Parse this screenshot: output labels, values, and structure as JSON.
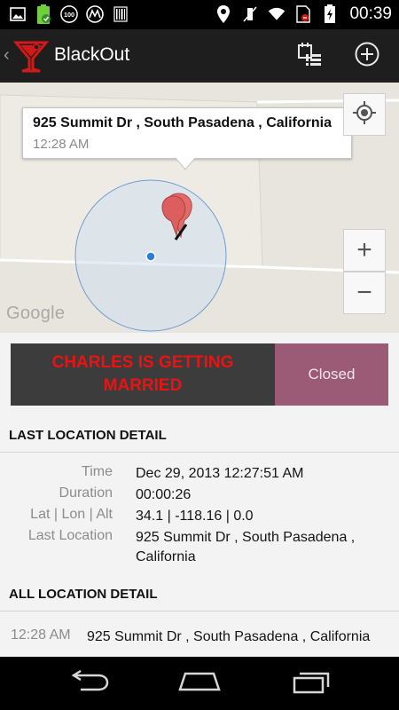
{
  "status_bar": {
    "time": "00:39",
    "icons": [
      "image-icon",
      "battery-icon",
      "app-100-icon",
      "motorola-icon",
      "barcode-icon",
      "location-icon",
      "mute-icon",
      "wifi-icon",
      "no-sim-icon",
      "battery-charging-icon"
    ]
  },
  "app": {
    "title": "BlackOut",
    "brand_color": "#d11919"
  },
  "map": {
    "info_address": "925 Summit Dr , South Pasadena , California",
    "info_time": "12:28 AM",
    "attribution": "Google",
    "zoom_in_label": "+",
    "zoom_out_label": "−"
  },
  "event": {
    "title": "CHARLES IS GETTING MARRIED",
    "status": "Closed",
    "title_color": "#ee1111",
    "status_bg": "#9b5a76"
  },
  "last_location": {
    "header": "LAST LOCATION DETAIL",
    "rows": [
      {
        "label": "Time",
        "value": "Dec 29, 2013 12:27:51 AM"
      },
      {
        "label": "Duration",
        "value": "00:00:26"
      },
      {
        "label": "Lat | Lon | Alt",
        "value": "34.1 | -118.16 | 0.0"
      },
      {
        "label": "Last Location",
        "value": "925 Summit Dr , South Pasadena , California"
      }
    ]
  },
  "all_locations": {
    "header": "ALL LOCATION DETAIL",
    "items": [
      {
        "time": "12:28 AM",
        "address": "925 Summit Dr , South Pasadena , California"
      }
    ]
  }
}
